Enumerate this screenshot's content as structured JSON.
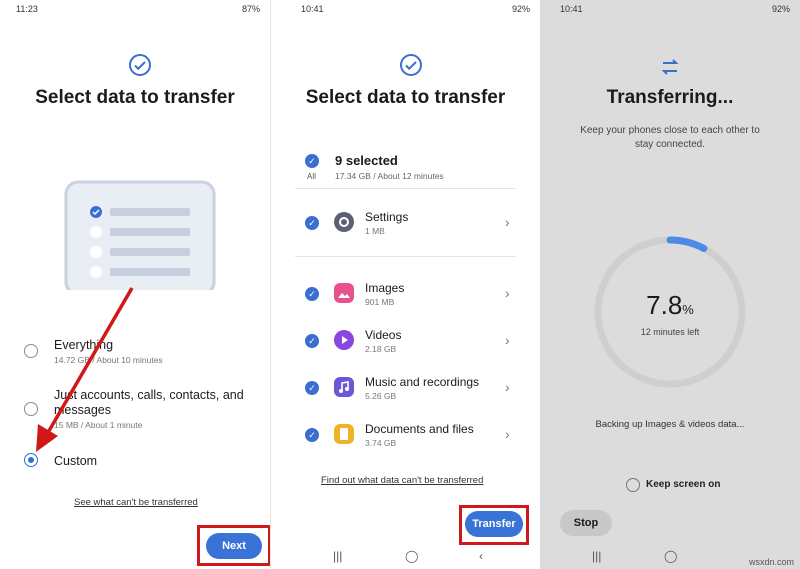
{
  "colors": {
    "accent": "#3a6fd0",
    "highlight": "#d01818",
    "progress": "#4c8ae6"
  },
  "screen1": {
    "status_time": "11:23",
    "status_right": "87%",
    "title": "Select data to transfer",
    "options": [
      {
        "label": "Everything",
        "sub": "14.72 GB / About 10 minutes"
      },
      {
        "label": "Just accounts, calls, contacts, and messages",
        "sub": "15 MB / About 1 minute"
      },
      {
        "label": "Custom",
        "sub": ""
      }
    ],
    "link": "See what can't be transferred",
    "next_label": "Next"
  },
  "screen2": {
    "status_time": "10:41",
    "status_right": "92%",
    "title": "Select data to transfer",
    "selected_title": "9 selected",
    "selected_sub": "17.34 GB / About 12 minutes",
    "all_label": "All",
    "items": [
      {
        "label": "Settings",
        "sub": "1 MB",
        "icon": "settings-gear-icon"
      },
      {
        "label": "Images",
        "sub": "901 MB",
        "icon": "images-icon"
      },
      {
        "label": "Videos",
        "sub": "2.18 GB",
        "icon": "videos-play-icon"
      },
      {
        "label": "Music and recordings",
        "sub": "5.26 GB",
        "icon": "music-note-icon"
      },
      {
        "label": "Documents and files",
        "sub": "3.74 GB",
        "icon": "document-icon"
      }
    ],
    "link": "Find out what data can't be transferred",
    "transfer_label": "Transfer"
  },
  "screen3": {
    "status_time": "10:41",
    "status_right": "92%",
    "title": "Transferring...",
    "subtitle_line1": "Keep your phones close to each other to",
    "subtitle_line2": "stay connected.",
    "percent_value": "7.8",
    "percent_sign": "%",
    "progress": 0.078,
    "time_left": "12 minutes left",
    "status": "Backing up Images & videos data...",
    "keep_screen": "Keep screen on",
    "stop_label": "Stop"
  },
  "watermark": "wsxdn.com"
}
